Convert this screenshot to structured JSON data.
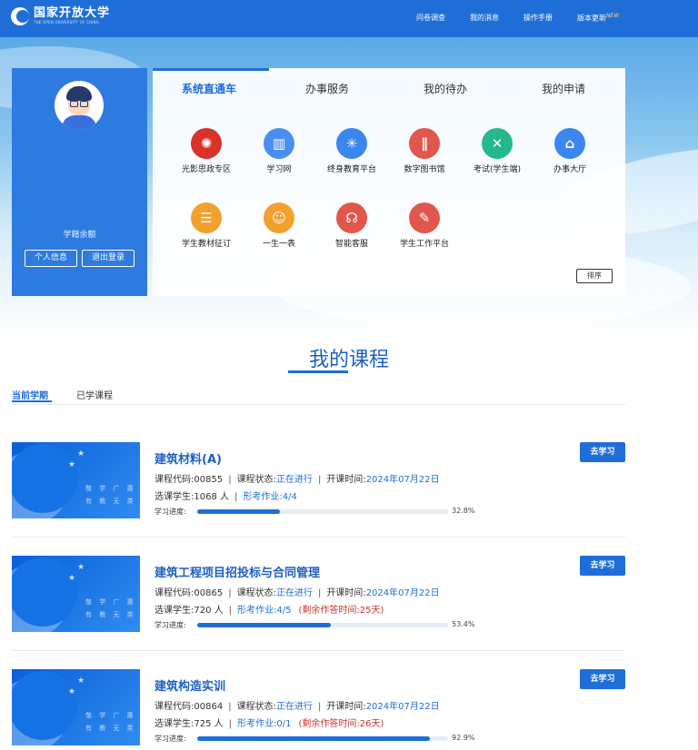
{
  "header": {
    "logo_cn": "国家开放大学",
    "logo_en": "THE OPEN UNIVERSITY OF CHINA",
    "nav": [
      {
        "label": "问卷调查"
      },
      {
        "label": "我的消息"
      },
      {
        "label": "操作手册"
      },
      {
        "label": "版本更新",
        "badge": "NEW"
      }
    ]
  },
  "profile": {
    "balance_label": "学籍余额",
    "info_button": "个人信息",
    "logout_button": "退出登录"
  },
  "service_panel": {
    "tabs": [
      "系统直通车",
      "办事服务",
      "我的待办",
      "我的申请"
    ],
    "active_tab": 0,
    "items": [
      {
        "label": "光影思政专区",
        "icon": "film-reel-icon",
        "color": "#d8322b"
      },
      {
        "label": "学习网",
        "icon": "open-book-icon",
        "color": "#4a8ff0"
      },
      {
        "label": "终身教育平台",
        "icon": "sparkle-icon",
        "color": "#3b86ef"
      },
      {
        "label": "数字图书馆",
        "icon": "bookshelf-icon",
        "color": "#e2574c"
      },
      {
        "label": "考试(学生端)",
        "icon": "pencil-ruler-icon",
        "color": "#25b88a"
      },
      {
        "label": "办事大厅",
        "icon": "building-icon",
        "color": "#3b86ef"
      },
      {
        "label": "学生教材征订",
        "icon": "list-icon",
        "color": "#f2a12e"
      },
      {
        "label": "一生一表",
        "icon": "person-icon",
        "color": "#f2a12e"
      },
      {
        "label": "智能客服",
        "icon": "headset-icon",
        "color": "#e2574c"
      },
      {
        "label": "学生工作平台",
        "icon": "reading-student-icon",
        "color": "#e2574c"
      }
    ],
    "sort_button": "排序"
  },
  "courses_section": {
    "title": "我的课程",
    "tabs": [
      "当前学期",
      "已学课程"
    ],
    "active_tab": 0,
    "thumb_motto": [
      "敬 学 广 惠",
      "有 教 无 类"
    ],
    "go_button": "去学习",
    "progress_label": "学习进度:",
    "courses": [
      {
        "title": "建筑材料(A)",
        "code_label": "课程代码:",
        "code": "00855",
        "status_label": "课程状态:",
        "status": "正在进行",
        "start_label": "开课时间:",
        "start": "2024年07月22日",
        "students_label": "选课学生:",
        "students": "1068 人",
        "assignment_label": "形考作业:",
        "assignment": "4/4",
        "remaining": "",
        "progress": 32.8,
        "progress_text": "32.8%"
      },
      {
        "title": "建筑工程项目招投标与合同管理",
        "code_label": "课程代码:",
        "code": "00865",
        "status_label": "课程状态:",
        "status": "正在进行",
        "start_label": "开课时间:",
        "start": "2024年07月22日",
        "students_label": "选课学生:",
        "students": "720 人",
        "assignment_label": "形考作业:",
        "assignment": "4/5",
        "remaining": "(剩余作答时间:25天)",
        "progress": 53.4,
        "progress_text": "53.4%"
      },
      {
        "title": "建筑构造实训",
        "code_label": "课程代码:",
        "code": "00864",
        "status_label": "课程状态:",
        "status": "正在进行",
        "start_label": "开课时间:",
        "start": "2024年07月22日",
        "students_label": "选课学生:",
        "students": "725 人",
        "assignment_label": "形考作业:",
        "assignment": "0/1",
        "remaining": "(剩余作答时间:26天)",
        "progress": 92.9,
        "progress_text": "92.9%"
      }
    ]
  }
}
